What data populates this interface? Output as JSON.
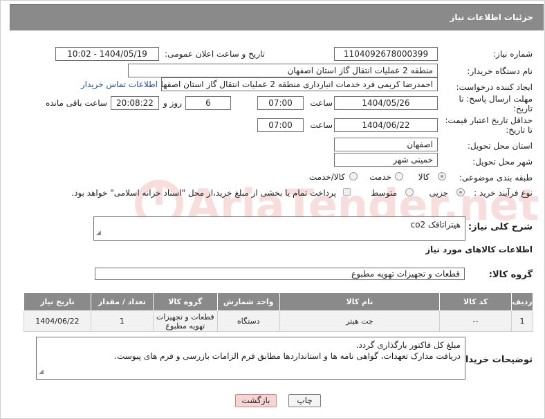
{
  "header": {
    "title": "جزئیات اطلاعات نیاز"
  },
  "fields": {
    "need_number_label": "شماره نیاز:",
    "need_number": "1104092678000399",
    "announce_label": "تاریخ و ساعت اعلان عمومی:",
    "announce_value": "1404/05/19 - 10:02",
    "buyer_org_label": "نام دستگاه خریدار:",
    "buyer_org": "منطقه 2 عملیات انتقال گاز استان اصفهان",
    "creator_label": "ایجاد کننده درخواست:",
    "creator": "احمدرضا کریمی فرد خدمات انبارداری منطقه 2 عملیات انتقال گاز استان اصفهان",
    "contact_link": "اطلاعات تماس خریدار",
    "deadline_label_1": "مهلت ارسال پاسخ: تا",
    "deadline_label_2": "تاریخ:",
    "deadline_date": "1404/05/26",
    "time_label": "ساعت",
    "deadline_time": "07:00",
    "days_value": "6",
    "days_label": "روز و",
    "remaining_time": "20:08:22",
    "remaining_label": "ساعت باقی مانده",
    "validity_label_1": "حداقل تاریخ اعتبار قیمت:",
    "validity_label_2": "تا تاریخ:",
    "validity_date": "1404/06/22",
    "validity_time": "07:00",
    "province_label": "استان محل تحویل:",
    "province": "اصفهان",
    "city_label": "شهر محل تحویل:",
    "city": "خمینی شهر",
    "category_label": "طبقه بندی موضوعی:",
    "category_options": [
      "کالا",
      "خدمت",
      "کالا/خدمت"
    ],
    "process_label": "نوع فرآیند خرید :",
    "process_options": [
      "جزیی",
      "متوسط"
    ],
    "payment_note": "پرداخت تمام یا بخشی از مبلغ خرید،از محل \"اسناد خزانه اسلامی\" خواهد بود."
  },
  "description": {
    "label": "شرح کلی نیاز:",
    "value": "هیتراتاقک co2"
  },
  "goods": {
    "section_title": "اطلاعات کالاهای مورد نیاز",
    "group_label": "گروه کالا:",
    "group_value": "قطعات و تجهیزات تهویه مطبوع",
    "columns": [
      "ردیف",
      "کد کالا",
      "نام کالا",
      "واحد شمارش",
      "گروه کالا",
      "تعداد / مقدار",
      "تاریخ نیاز"
    ],
    "rows": [
      [
        "1",
        "--",
        "جت هیتر",
        "دستگاه",
        "قطعات و تجهیزات تهویه مطبوع",
        "1",
        "1404/06/22"
      ]
    ]
  },
  "buyer_notes": {
    "label": "توضیحات خریدار:",
    "line1": "مبلغ کل فاکتور بارگذاری گردد.",
    "line2": "دریافت مدارک تعهدات، گواهی نامه ها و استانداردها مطابق فرم الزامات بازرسی و فرم های پیوست."
  },
  "buttons": {
    "print": "چاپ",
    "back": "بازگشت"
  },
  "colors": {
    "header_bg": "#8a8a8a",
    "link": "#1d4f9e",
    "back_btn_bg": "#f7d5d5"
  },
  "watermark": {
    "text": "AriaTender.net"
  }
}
